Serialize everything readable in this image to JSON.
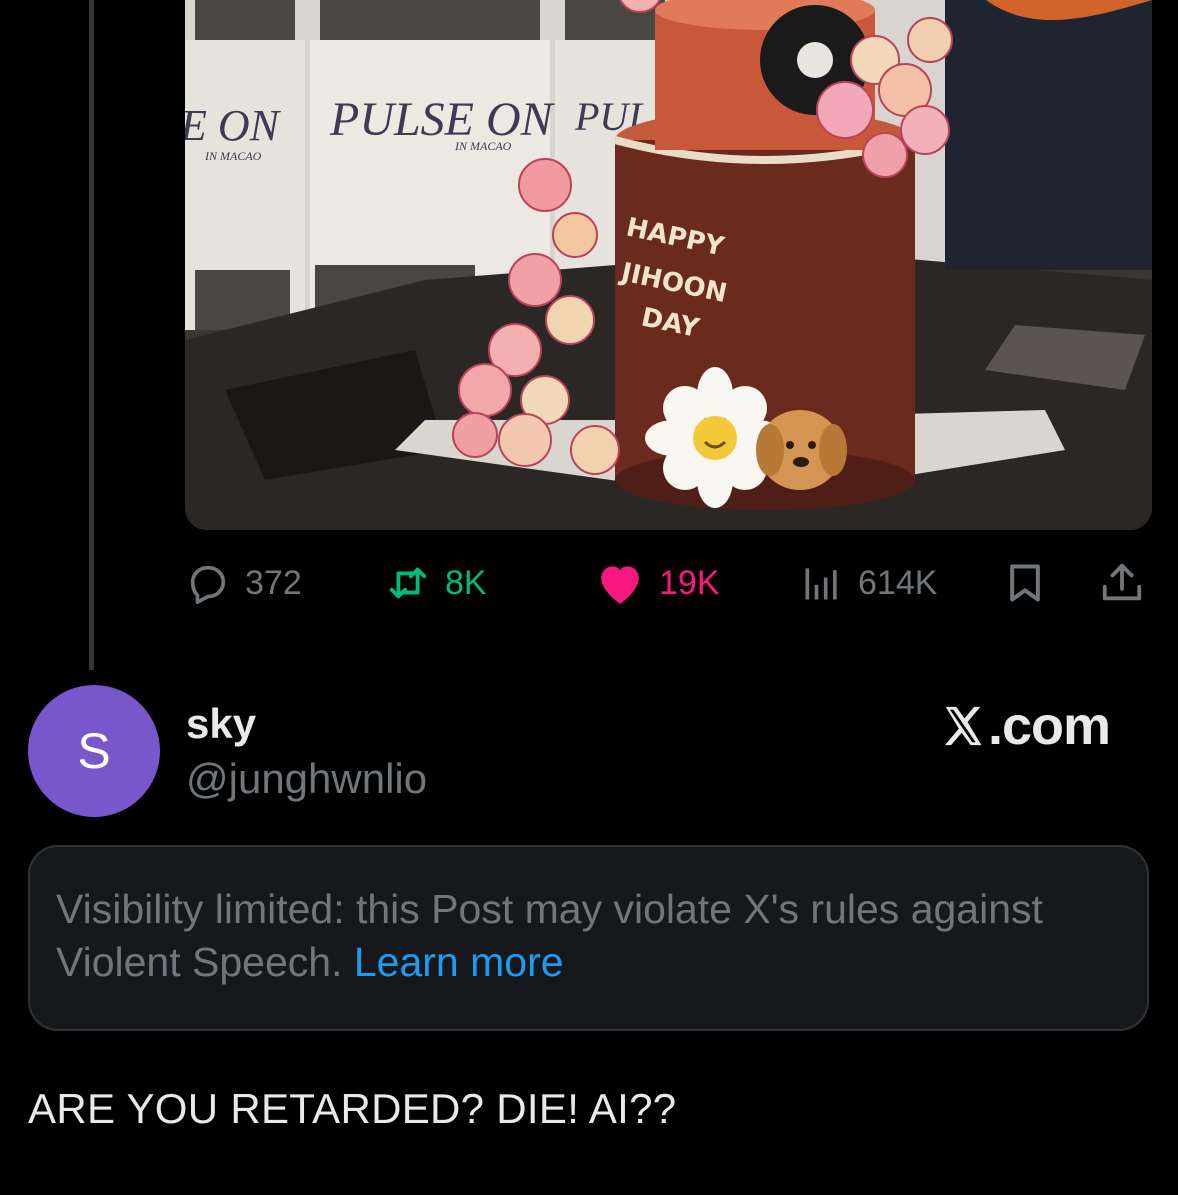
{
  "media": {
    "cake_text": [
      "HAPPY",
      "JIHOON",
      "DAY"
    ],
    "poster_text": [
      "E ON",
      "PULSE ON",
      "PUL"
    ],
    "poster_subtext": [
      "IN MACAO",
      "IN MACAO"
    ]
  },
  "actions": {
    "replies": "372",
    "reposts": "8K",
    "likes": "19K",
    "views": "614K",
    "repost_color": "#00ba7c",
    "like_color": "#f91880",
    "muted_color": "#71767b"
  },
  "quoted_post": {
    "avatar_letter": "S",
    "avatar_color": "#7856cc",
    "display_name": "sky",
    "handle": "@junghwnlio",
    "source": ".com"
  },
  "notice": {
    "text": "Visibility limited: this Post may violate X's rules against Violent Speech. ",
    "link": "Learn more",
    "link_color": "#1d9bf0"
  },
  "post_text": "ARE YOU RETARDED? DIE! AI??"
}
